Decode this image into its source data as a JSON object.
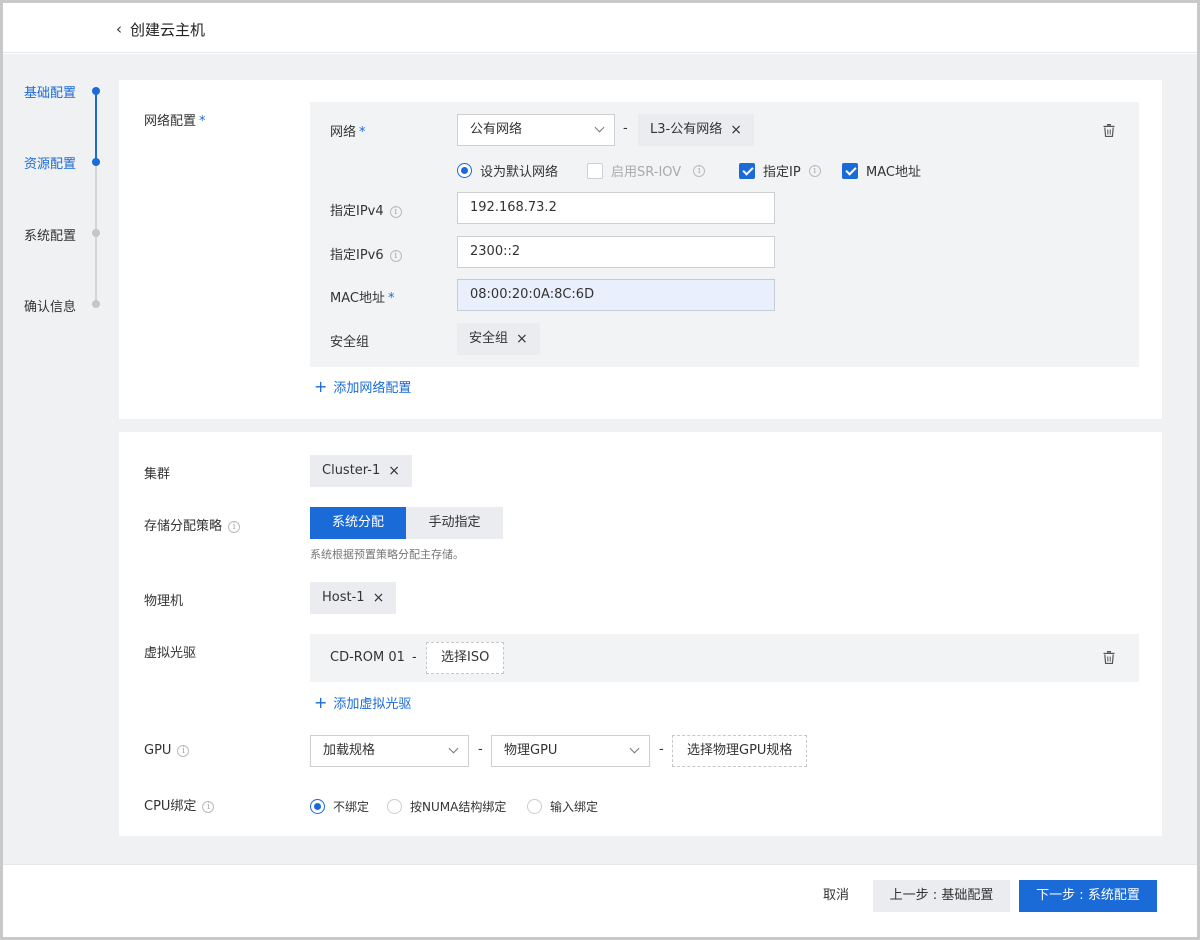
{
  "header": {
    "title": "创建云主机"
  },
  "steps": [
    {
      "label": "基础配置",
      "state": "done"
    },
    {
      "label": "资源配置",
      "state": "active"
    },
    {
      "label": "系统配置",
      "state": "pending"
    },
    {
      "label": "确认信息",
      "state": "pending"
    }
  ],
  "network": {
    "section_label": "网络配置",
    "required_mark": "*",
    "network_label": "网络",
    "network_value": "公有网络",
    "network_tag": "L3-公有网络",
    "dash": "-",
    "default_network_label": "设为默认网络",
    "sriov_label": "启用SR-IOV",
    "assign_ip_label": "指定IP",
    "mac_checkbox_label": "MAC地址",
    "ipv4_label": "指定IPv4",
    "ipv4_value": "192.168.73.2",
    "ipv6_label": "指定IPv6",
    "ipv6_value": "2300::2",
    "mac_label": "MAC地址",
    "mac_value": "08:00:20:0A:8C:6D",
    "security_group_label": "安全组",
    "security_group_tag": "安全组",
    "add_network_label": "添加网络配置"
  },
  "resources": {
    "cluster_label": "集群",
    "cluster_tag": "Cluster-1",
    "storage_label": "存储分配策略",
    "storage_options": [
      "系统分配",
      "手动指定"
    ],
    "storage_hint": "系统根据预置策略分配主存储。",
    "host_label": "物理机",
    "host_tag": "Host-1",
    "cdrom_section_label": "虚拟光驱",
    "cdrom_name": "CD-ROM 01",
    "cdrom_dash": "-",
    "select_iso_label": "选择ISO",
    "add_cdrom_label": "添加虚拟光驱",
    "gpu_label": "GPU",
    "gpu_load_value": "加载规格",
    "gpu_type_value": "物理GPU",
    "gpu_select_label": "选择物理GPU规格",
    "cpu_label": "CPU绑定",
    "cpu_options": [
      "不绑定",
      "按NUMA结构绑定",
      "输入绑定"
    ],
    "cpu_selected": "不绑定"
  },
  "footer": {
    "cancel_label": "取消",
    "prev_label": "上一步 : 基础配置",
    "next_label": "下一步 : 系统配置"
  },
  "colors": {
    "accent": "#1a6ad8",
    "workspace_bg": "#f0f1f3",
    "field_bg": "#f2f3f5"
  },
  "checkbox_states": {
    "default_network": true,
    "sriov": false,
    "assign_ip": true,
    "mac": true
  }
}
